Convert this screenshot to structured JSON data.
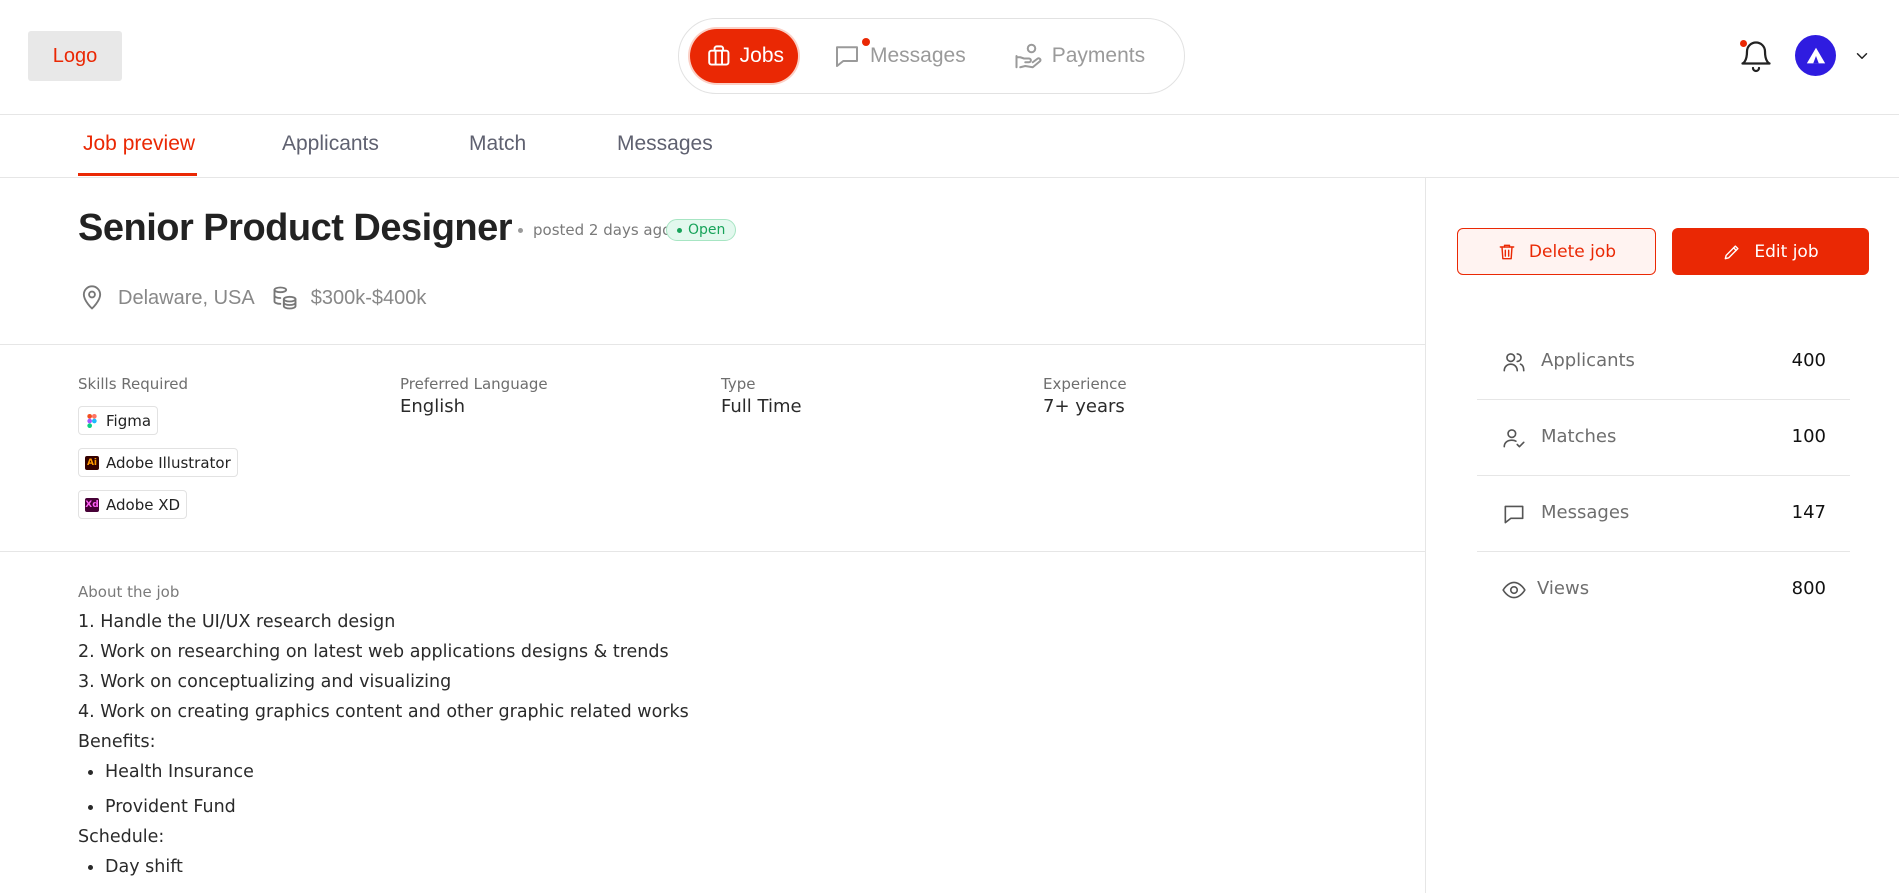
{
  "header": {
    "logo": "Logo",
    "nav": [
      {
        "label": "Jobs",
        "icon": "briefcase-icon",
        "active": true
      },
      {
        "label": "Messages",
        "icon": "chat-icon",
        "active": false
      },
      {
        "label": "Payments",
        "icon": "hand-coins-icon",
        "active": false
      }
    ]
  },
  "tabs": [
    {
      "label": "Job preview",
      "active": true
    },
    {
      "label": "Applicants"
    },
    {
      "label": "Match"
    },
    {
      "label": "Messages"
    }
  ],
  "job": {
    "title": "Senior Product Designer",
    "posted": "posted 2 days ago",
    "status": "Open",
    "location": "Delaware, USA",
    "salary": "$300k-$400k"
  },
  "meta": {
    "skills_label": "Skills Required",
    "skills": [
      "Figma",
      "Adobe Illustrator",
      "Adobe XD"
    ],
    "language_label": "Preferred Language",
    "language": "English",
    "type_label": "Type",
    "type": "Full Time",
    "experience_label": "Experience",
    "experience": "7+ years"
  },
  "about": {
    "label": "About the job",
    "lines": [
      "1. Handle the UI/UX research design",
      "2. Work on researching on latest web applications designs & trends",
      "3. Work on conceptualizing and visualizing",
      "4. Work on creating graphics content and other graphic related works"
    ],
    "benefits_label": "Benefits:",
    "benefits": [
      "Health Insurance",
      "Provident Fund"
    ],
    "schedule_label": "Schedule:",
    "schedule": [
      "Day shift"
    ]
  },
  "actions": {
    "delete": "Delete job",
    "edit": "Edit job"
  },
  "stats": [
    {
      "label": "Applicants",
      "value": "400",
      "icon": "users-icon"
    },
    {
      "label": "Matches",
      "value": "100",
      "icon": "user-check-icon"
    },
    {
      "label": "Messages",
      "value": "147",
      "icon": "chat-icon"
    },
    {
      "label": "Views",
      "value": "800",
      "icon": "eye-icon"
    }
  ],
  "colors": {
    "accent": "#ea2804",
    "status_green": "#18a35a",
    "avatar": "#2f1ce0"
  }
}
